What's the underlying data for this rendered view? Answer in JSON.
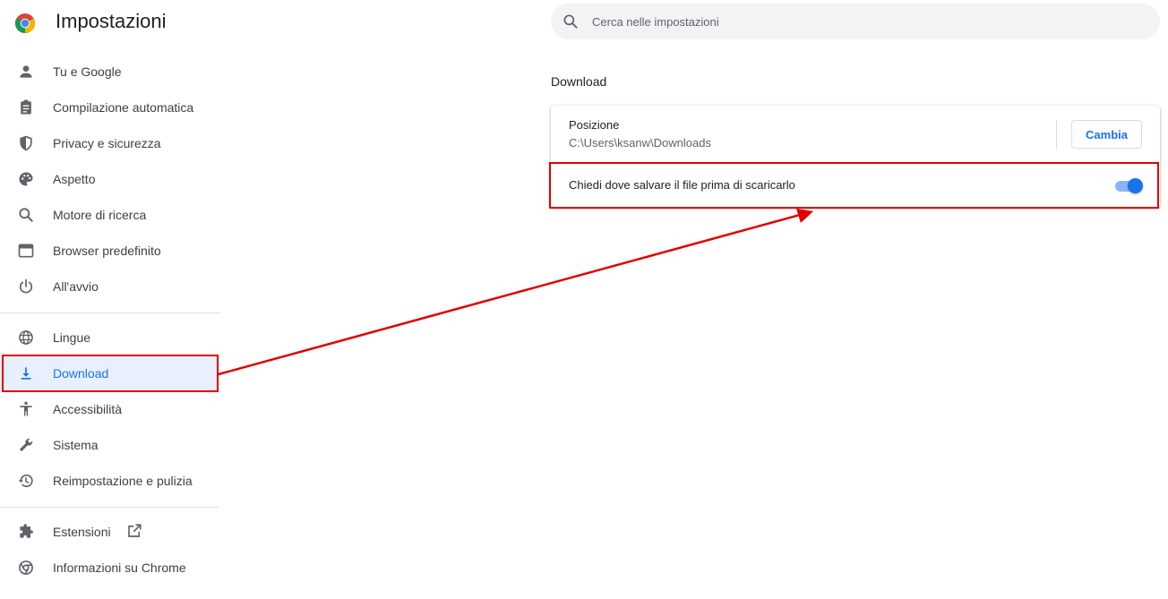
{
  "app": {
    "title": "Impostazioni",
    "logo_icon": "chrome-logo-icon"
  },
  "search": {
    "placeholder": "Cerca nelle impostazioni",
    "value": ""
  },
  "sidebar": {
    "groups": [
      {
        "items": [
          {
            "label": "Tu e Google",
            "icon": "person-icon"
          },
          {
            "label": "Compilazione automatica",
            "icon": "clipboard-icon"
          },
          {
            "label": "Privacy e sicurezza",
            "icon": "shield-icon"
          },
          {
            "label": "Aspetto",
            "icon": "palette-icon"
          },
          {
            "label": "Motore di ricerca",
            "icon": "search-icon"
          },
          {
            "label": "Browser predefinito",
            "icon": "browser-window-icon"
          },
          {
            "label": "All'avvio",
            "icon": "power-icon"
          }
        ]
      },
      {
        "items": [
          {
            "label": "Lingue",
            "icon": "globe-icon"
          },
          {
            "label": "Download",
            "icon": "download-icon",
            "active": true
          },
          {
            "label": "Accessibilità",
            "icon": "accessibility-icon"
          },
          {
            "label": "Sistema",
            "icon": "wrench-icon"
          },
          {
            "label": "Reimpostazione e pulizia",
            "icon": "history-icon"
          }
        ]
      },
      {
        "items": [
          {
            "label": "Estensioni",
            "icon": "puzzle-icon",
            "external_icon": "open-in-new-icon"
          },
          {
            "label": "Informazioni su Chrome",
            "icon": "chrome-icon"
          }
        ]
      }
    ]
  },
  "main": {
    "section_title": "Download",
    "location": {
      "label": "Posizione",
      "value": "C:\\Users\\ksanw\\Downloads",
      "button": "Cambia"
    },
    "ask_before_download": {
      "label": "Chiedi dove salvare il file prima di scaricarlo",
      "enabled": true
    }
  },
  "colors": {
    "accent": "#1a73e8",
    "active_bg": "#e8f0fe",
    "annotation": "#e00000",
    "toggle_track": "#8ab4f8"
  }
}
